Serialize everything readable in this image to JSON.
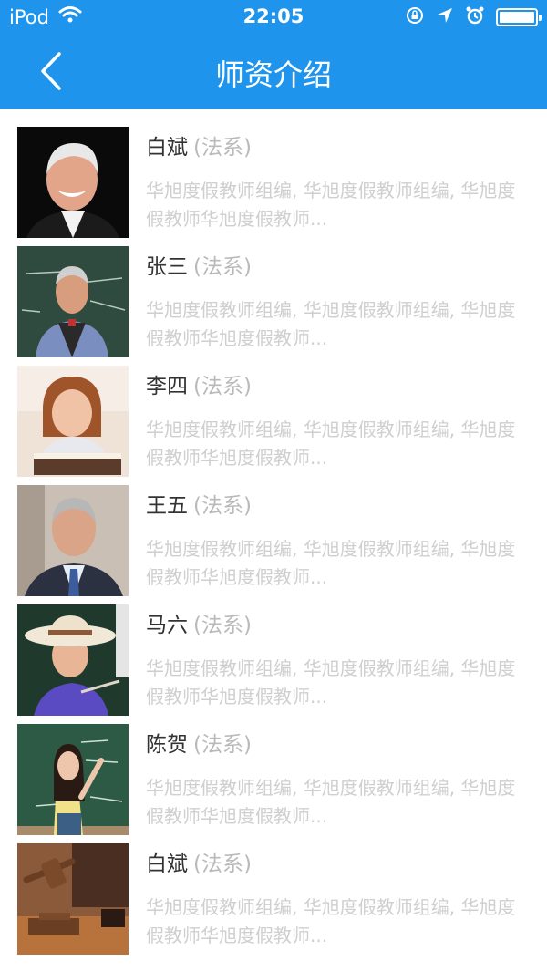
{
  "status_bar": {
    "carrier": "iPod",
    "time": "22:05"
  },
  "nav": {
    "title": "师资介绍"
  },
  "colors": {
    "header_bg": "#1e94ec",
    "name_text": "#333333",
    "dept_text": "#b9b9b9",
    "desc_text": "#cfcfcf"
  },
  "teachers": [
    {
      "name": "白斌",
      "dept": "(法系)",
      "desc": "华旭度假教师组编, 华旭度假教师组编, 华旭度假教师华旭度假教师..."
    },
    {
      "name": "张三",
      "dept": "(法系)",
      "desc": "华旭度假教师组编, 华旭度假教师组编, 华旭度假教师华旭度假教师..."
    },
    {
      "name": "李四",
      "dept": "(法系)",
      "desc": "华旭度假教师组编, 华旭度假教师组编, 华旭度假教师华旭度假教师..."
    },
    {
      "name": "王五",
      "dept": "(法系)",
      "desc": "华旭度假教师组编, 华旭度假教师组编, 华旭度假教师华旭度假教师..."
    },
    {
      "name": "马六",
      "dept": "(法系)",
      "desc": "华旭度假教师组编, 华旭度假教师组编, 华旭度假教师华旭度假教师..."
    },
    {
      "name": "陈贺",
      "dept": "(法系)",
      "desc": "华旭度假教师组编, 华旭度假教师组编, 华旭度假教师华旭度假教师..."
    },
    {
      "name": "白斌",
      "dept": "(法系)",
      "desc": "华旭度假教师组编, 华旭度假教师组编, 华旭度假教师华旭度假教师..."
    }
  ]
}
